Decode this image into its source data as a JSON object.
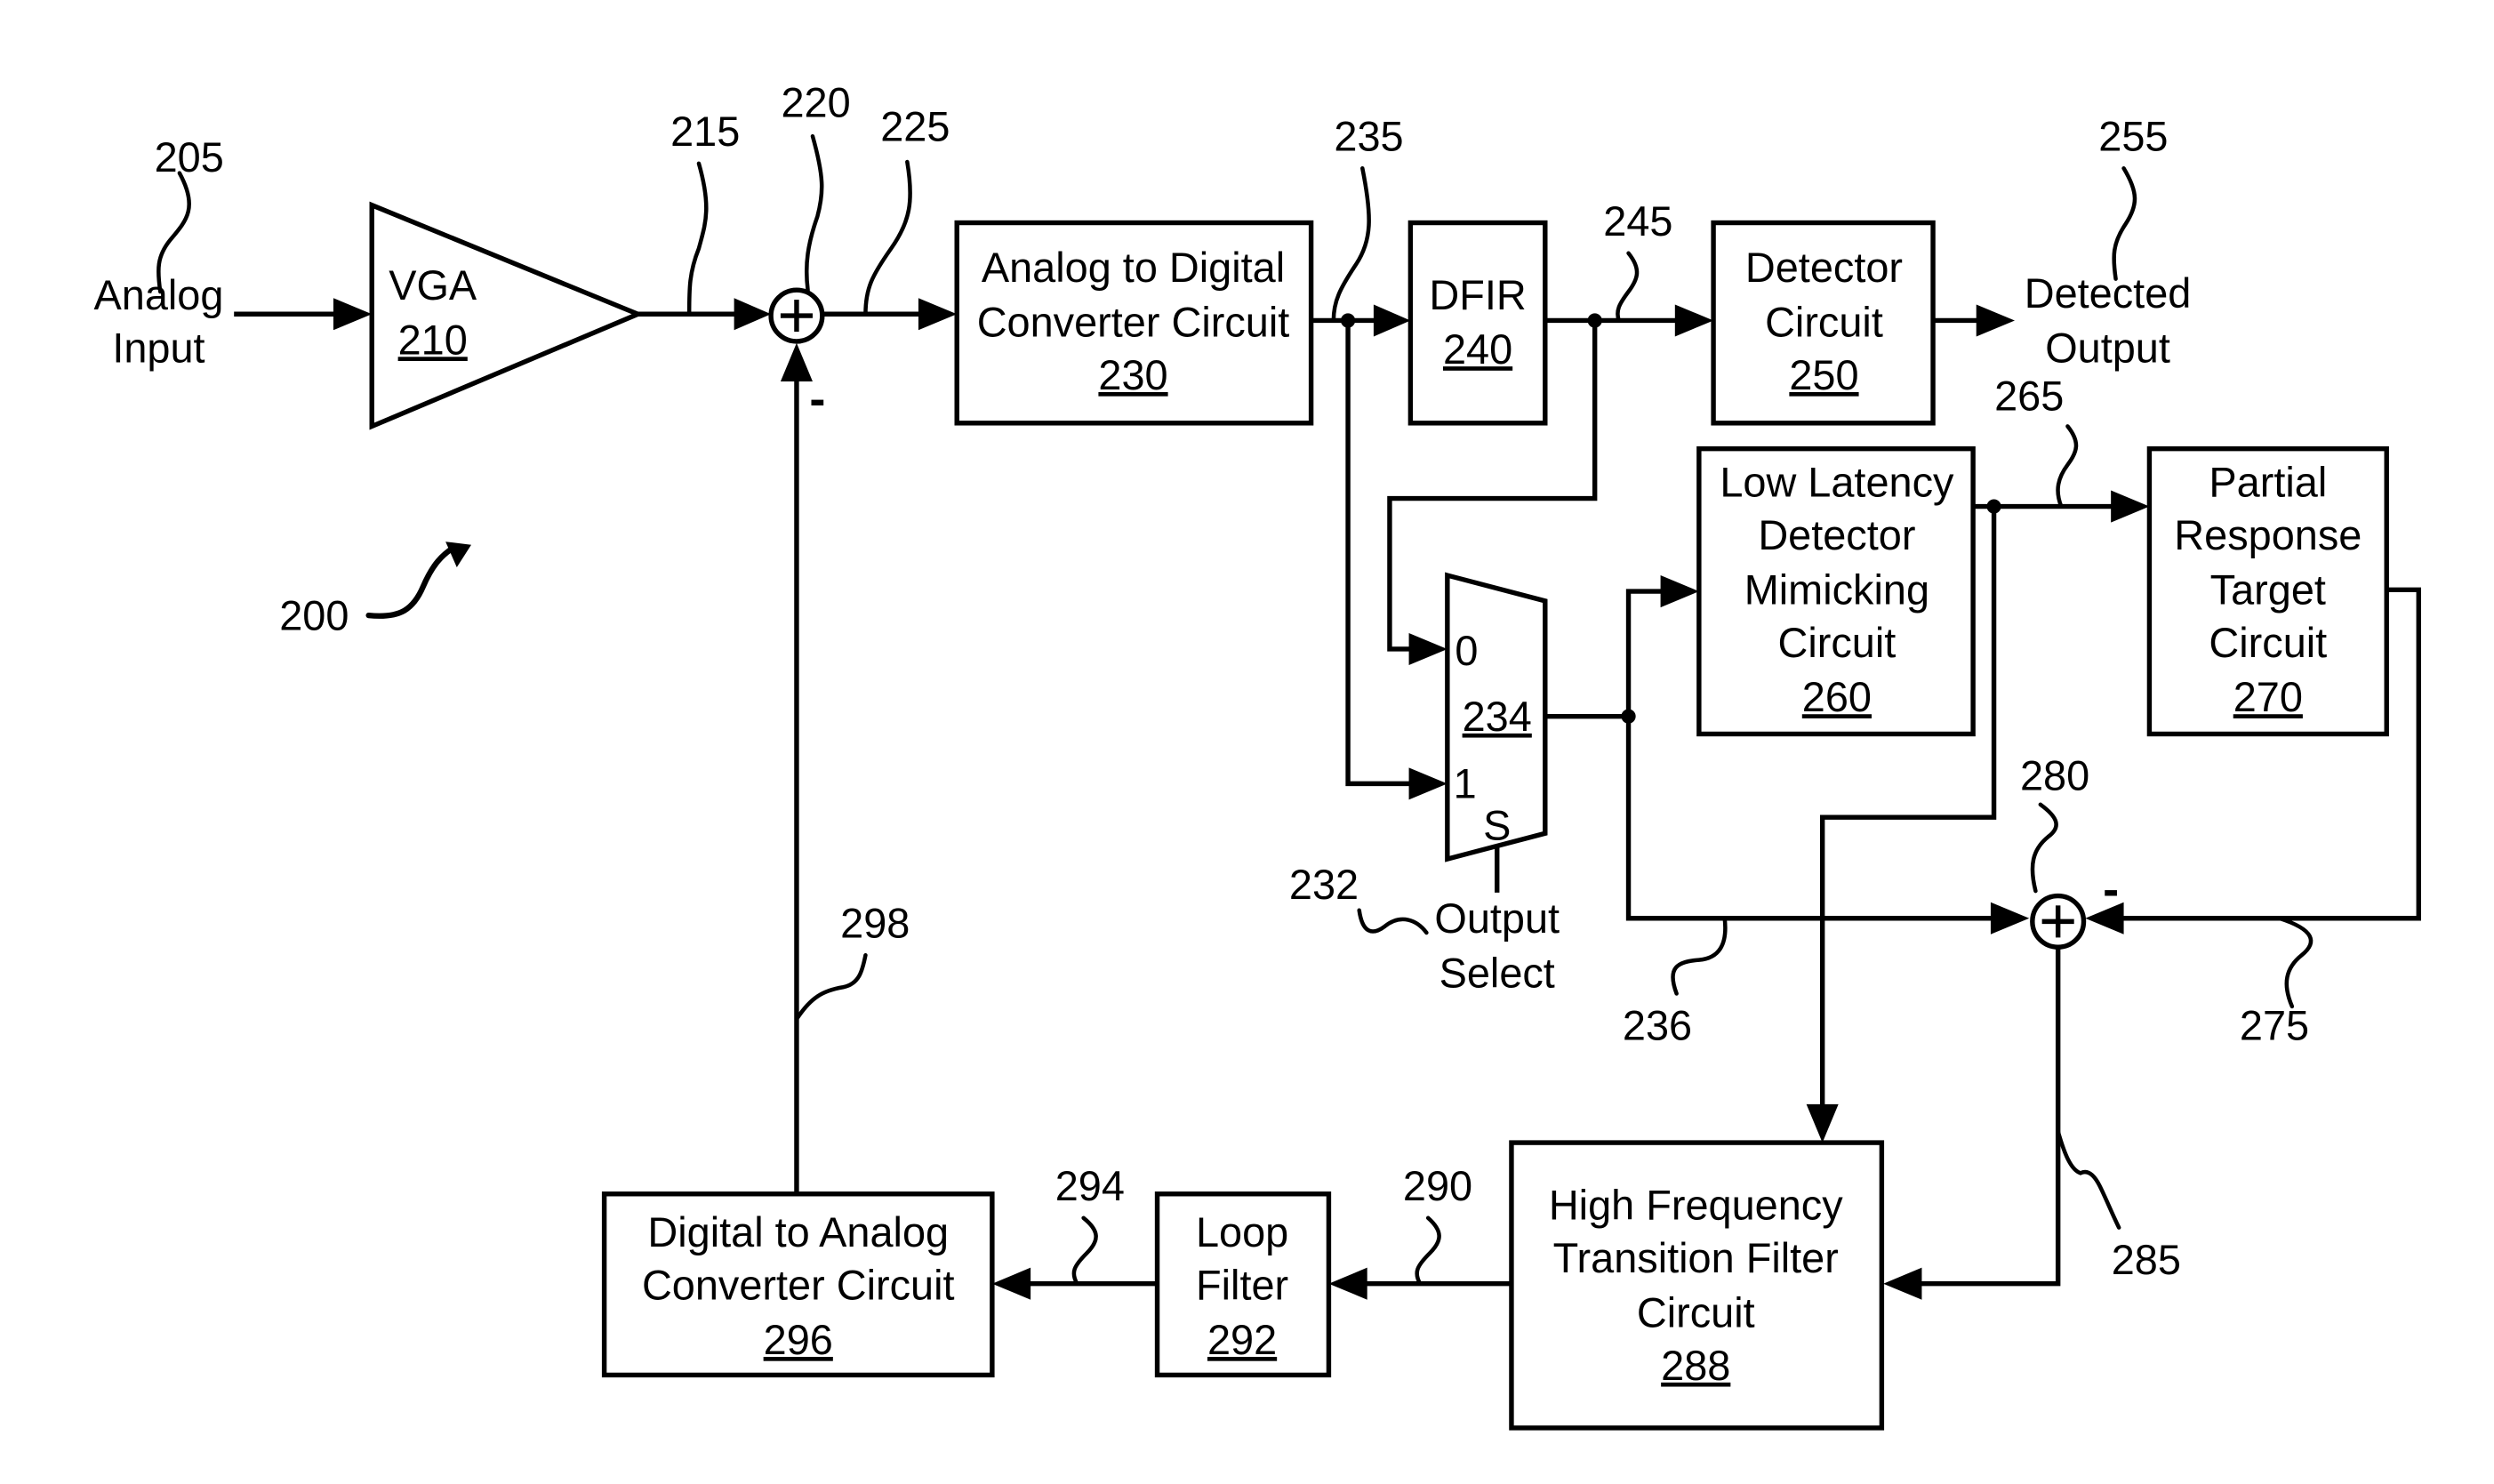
{
  "diagram": {
    "figure_ref": "200",
    "analog_input": {
      "label_lines": [
        "Analog",
        "Input"
      ],
      "ref": "205"
    },
    "vga": {
      "label": "VGA",
      "ref": "210"
    },
    "signals": {
      "s215": "215",
      "s225": "225",
      "s235": "235",
      "s236": "236",
      "s245": "245",
      "s255": "255",
      "s265": "265",
      "s275": "275",
      "s285": "285",
      "s290": "290",
      "s294": "294",
      "s298": "298"
    },
    "summer_top": {
      "ref": "220",
      "plus": "+",
      "minus": "-"
    },
    "summer_bottom": {
      "ref": "280",
      "plus": "+",
      "minus": "-"
    },
    "adc": {
      "label_lines": [
        "Analog to Digital",
        "Converter Circuit"
      ],
      "ref": "230"
    },
    "dfir": {
      "label": "DFIR",
      "ref": "240"
    },
    "detector": {
      "label_lines": [
        "Detector",
        "Circuit"
      ],
      "ref": "250"
    },
    "detected_output": {
      "label_lines": [
        "Detected",
        "Output"
      ]
    },
    "mux": {
      "ref": "234",
      "input0": "0",
      "input1": "1",
      "select": "S"
    },
    "output_select": {
      "label_lines": [
        "Output",
        "Select"
      ],
      "ref": "232"
    },
    "low_latency": {
      "label_lines": [
        "Low Latency",
        "Detector",
        "Mimicking",
        "Circuit"
      ],
      "ref": "260"
    },
    "partial_response": {
      "label_lines": [
        "Partial",
        "Response",
        "Target",
        "Circuit"
      ],
      "ref": "270"
    },
    "hf_filter": {
      "label_lines": [
        "High Frequency",
        "Transition Filter",
        "Circuit"
      ],
      "ref": "288"
    },
    "loop_filter": {
      "label_lines": [
        "Loop",
        "Filter"
      ],
      "ref": "292"
    },
    "dac": {
      "label_lines": [
        "Digital to Analog",
        "Converter Circuit"
      ],
      "ref": "296"
    }
  },
  "colors": {
    "ink": "#000000",
    "background": "#ffffff"
  }
}
